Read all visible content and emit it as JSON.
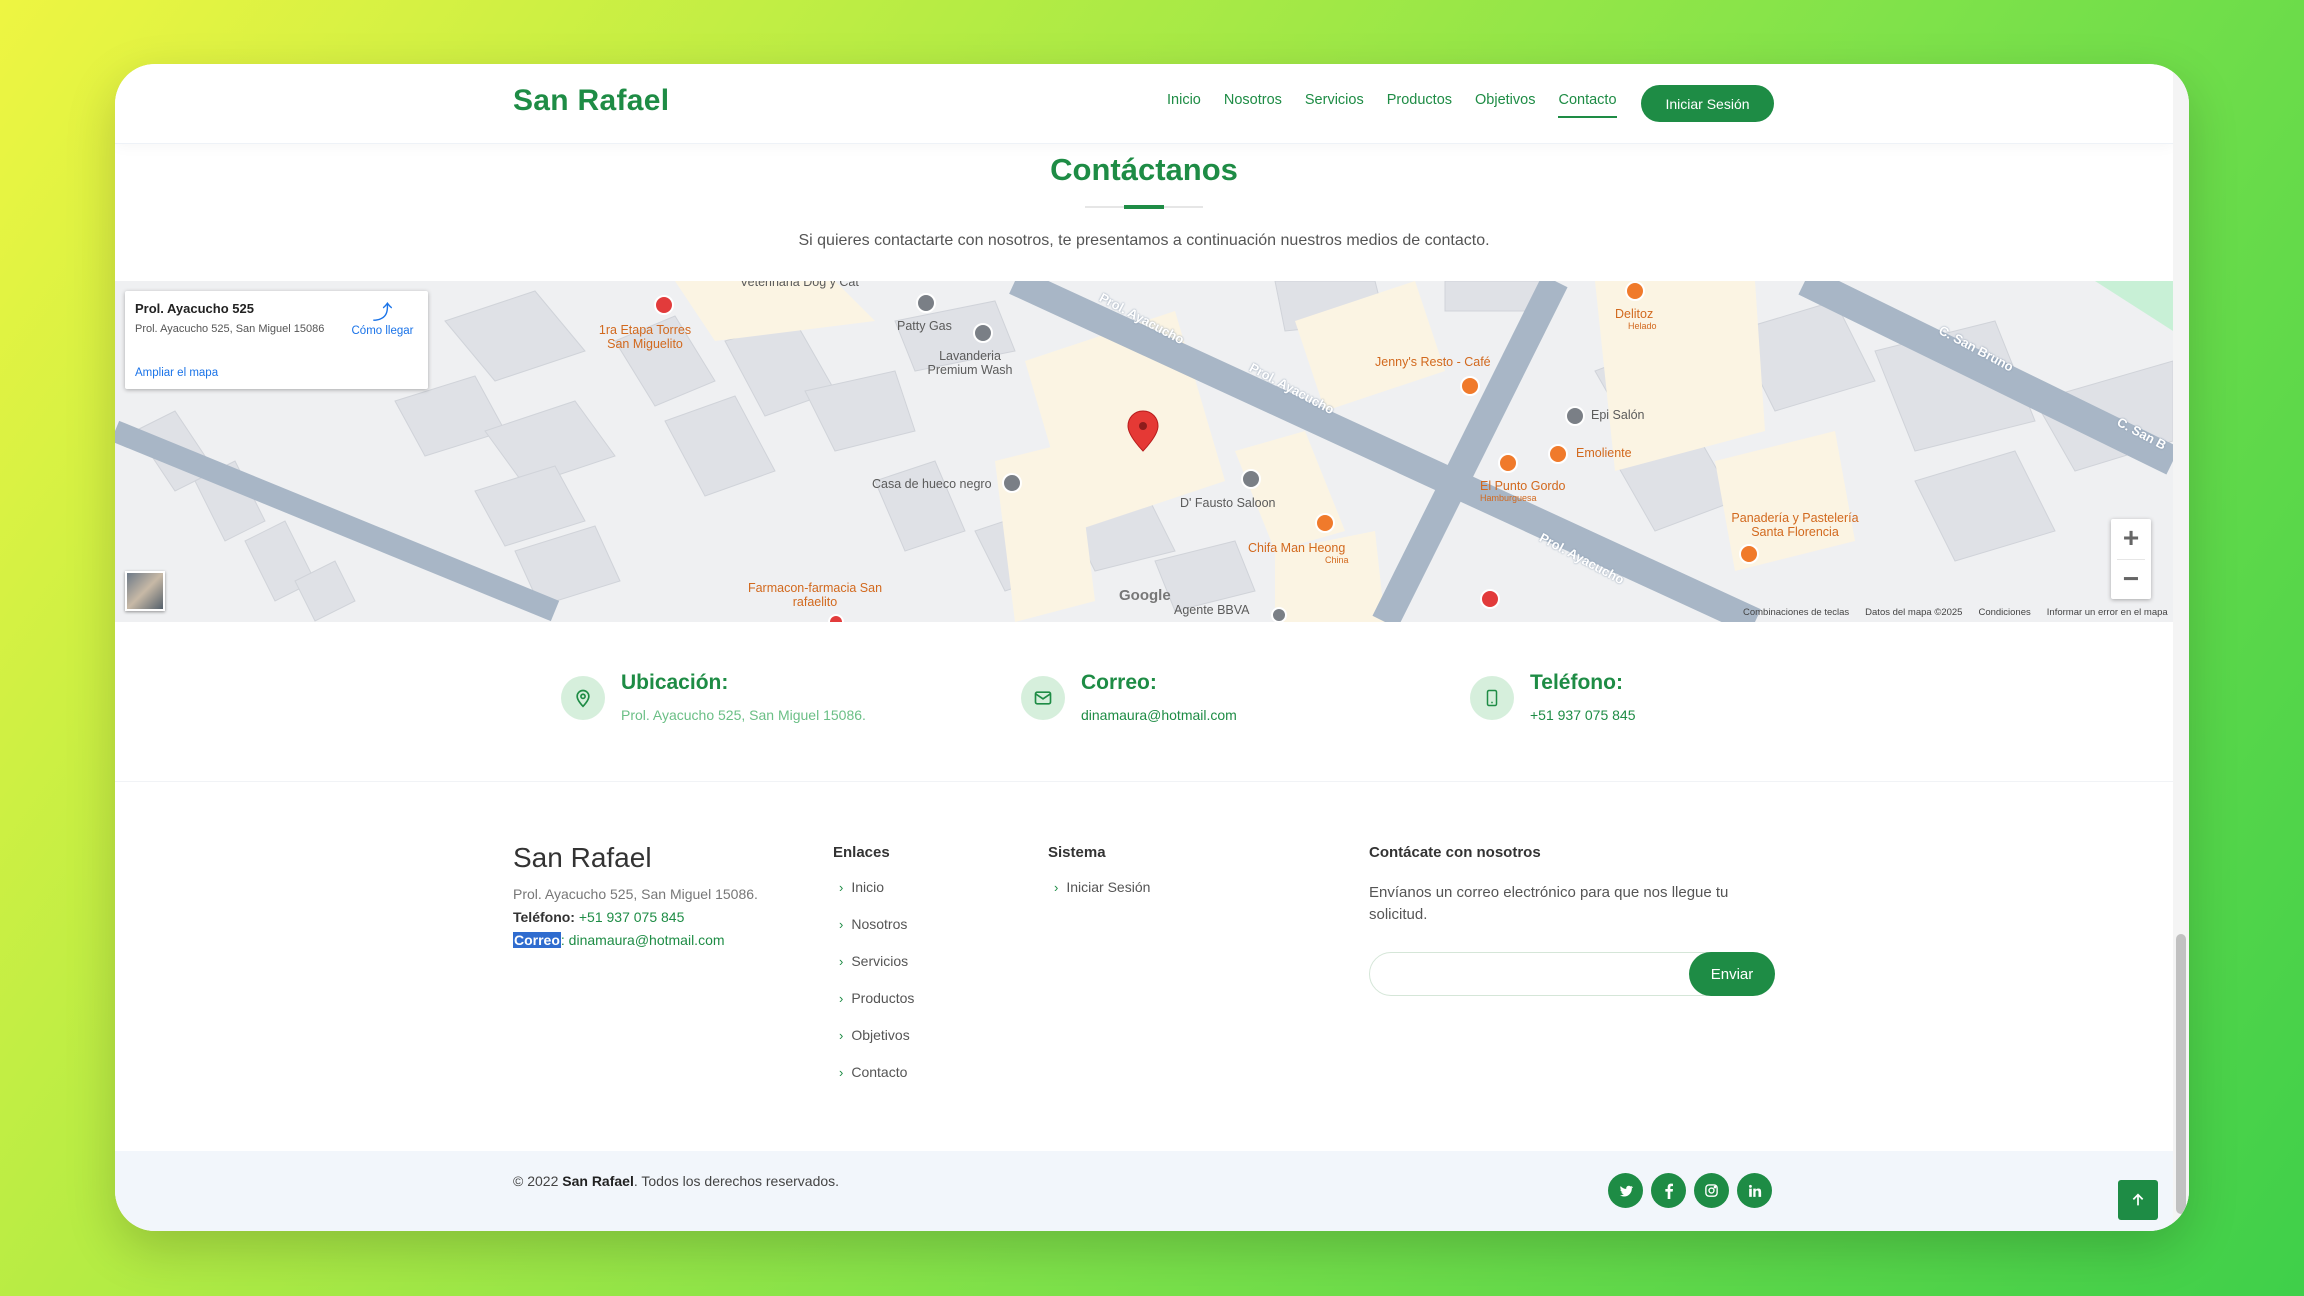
{
  "header": {
    "brand": "San Rafael",
    "nav": [
      "Inicio",
      "Nosotros",
      "Servicios",
      "Productos",
      "Objetivos",
      "Contacto"
    ],
    "active_nav": "Contacto",
    "login_label": "Iniciar Sesión"
  },
  "contact": {
    "title": "Contáctanos",
    "subtitle": "Si quieres contactarte con nosotros, te presentamos a continuación nuestros medios de contacto."
  },
  "map": {
    "card_title": "Prol. Ayacucho 525",
    "card_address": "Prol. Ayacucho 525, San Miguel 15086",
    "card_link": "Ampliar el mapa",
    "directions": "Cómo llegar",
    "labels": {
      "veterinaria": "Veterinaria Dog y Cat",
      "etapa": "1ra Etapa Torres San Miguelito",
      "patty": "Patty Gas",
      "lavanderia": "Lavanderia Premium Wash",
      "casa": "Casa de hueco negro",
      "fausto": "D' Fausto Saloon",
      "chifa": "Chifa Man Heong",
      "chifa_sub": "China",
      "farmacon": "Farmacon-farmacia San rafaelito",
      "agente": "Agente BBVA",
      "jennys": "Jenny's Resto - Café",
      "delitoz": "Delitoz",
      "delitoz_sub": "Helado",
      "epi": "Epi Salón",
      "emoliente": "Emoliente",
      "punto": "El Punto Gordo",
      "punto_sub": "Hamburguesa",
      "panaderia": "Panadería y Pastelería Santa Florencia",
      "road1": "Prol. Ayacucho",
      "road2": "Prol. Ayacucho",
      "road3": "Prol. Ayacucho",
      "road4": "C. San Bruno",
      "road5": "C. San B"
    },
    "attribution": [
      "Combinaciones de teclas",
      "Datos del mapa ©2025",
      "Condiciones",
      "Informar un error en el mapa"
    ],
    "google": "Google",
    "zoom_in": "+",
    "zoom_out": "−"
  },
  "info": [
    {
      "title": "Ubicación:",
      "value": "Prol. Ayacucho 525, San Miguel 15086.",
      "icon": "map-pin-icon"
    },
    {
      "title": "Correo:",
      "value": "dinamaura@hotmail.com",
      "icon": "envelope-icon"
    },
    {
      "title": "Teléfono:",
      "value": "+51 937 075 845",
      "icon": "phone-icon"
    }
  ],
  "footer": {
    "brand": "San Rafael",
    "address": "Prol. Ayacucho 525, San Miguel 15086.",
    "tel_label": "Teléfono:",
    "tel_value": "+51 937 075 845",
    "mail_label": "Correo",
    "mail_value": ": dinamaura@hotmail.com",
    "links_title": "Enlaces",
    "links": [
      "Inicio",
      "Nosotros",
      "Servicios",
      "Productos",
      "Objetivos",
      "Contacto"
    ],
    "system_title": "Sistema",
    "system_links": [
      "Iniciar Sesión"
    ],
    "newsletter_title": "Contácate con nosotros",
    "newsletter_text": "Envíanos un correo electrónico para que nos llegue tu solicitud.",
    "email_placeholder": "",
    "send_label": "Enviar"
  },
  "bottom": {
    "copy_prefix": "© 2022 ",
    "copy_brand": "San Rafael",
    "copy_suffix": ". Todos los derechos reservados.",
    "socials": [
      "twitter-icon",
      "facebook-icon",
      "instagram-icon",
      "linkedin-icon"
    ]
  },
  "colors": {
    "accent": "#1e8c45",
    "accent_light": "#d6efdc",
    "map_road": "#a8b6c6"
  }
}
